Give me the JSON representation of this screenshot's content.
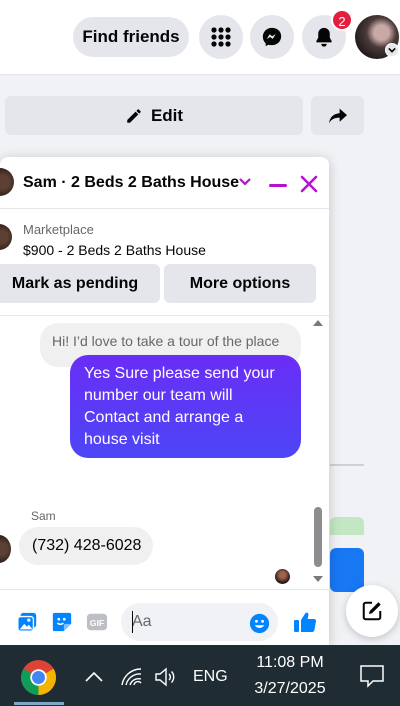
{
  "nav": {
    "find_friends": "Find friends",
    "notification_count": "2"
  },
  "page": {
    "edit_label": "Edit"
  },
  "chat": {
    "title": "Sam · 2 Beds 2 Baths House",
    "marketplace_label": "Marketplace",
    "listing": "$900 - 2 Beds 2 Baths House",
    "mark_pending": "Mark as pending",
    "more_options": "More options",
    "messages": [
      {
        "from": "Sam",
        "text": "Hi! I’d love to take a tour of the place"
      },
      {
        "from": "me",
        "text": "Yes Sure please send your number our team will Contact and arrange a house visit"
      },
      {
        "from": "Sam",
        "text": "(732) 428-6028"
      }
    ],
    "sender_name": "Sam",
    "composer_placeholder": "Aa"
  },
  "taskbar": {
    "language": "ENG",
    "time": "11:08 PM",
    "date": "3/27/2025"
  },
  "colors": {
    "accent": "#b412cf",
    "bubble_out_top": "#6a2df6",
    "bubble_out_bottom": "#4d46f6",
    "fb_blue": "#1877f2",
    "taskbar": "#1f2c33"
  },
  "icons": [
    "menu-grid-icon",
    "messenger-icon",
    "bell-icon",
    "pencil-icon",
    "share-arrow-icon",
    "chevron-down-icon",
    "minimize-icon",
    "close-icon",
    "photo-icon",
    "sticker-icon",
    "gif-icon",
    "emoji-icon",
    "like-icon",
    "compose-icon",
    "chrome-icon",
    "chevron-up-icon",
    "wifi-icon",
    "volume-icon",
    "notification-center-icon"
  ]
}
